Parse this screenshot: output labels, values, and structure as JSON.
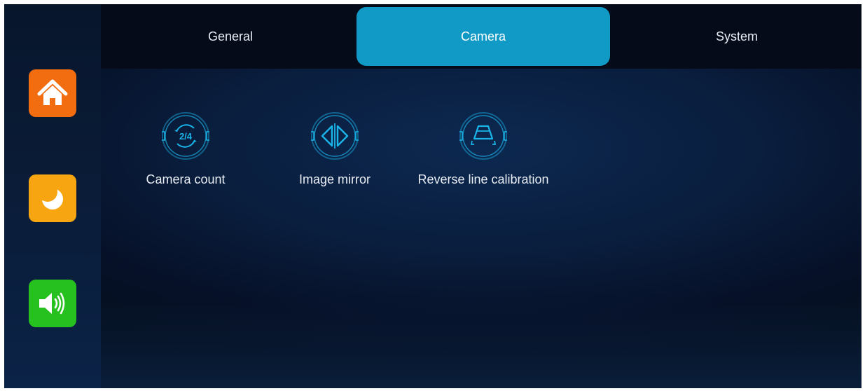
{
  "tabs": {
    "general": "General",
    "camera": "Camera",
    "system": "System",
    "active": "Camera"
  },
  "sidebar": {
    "home_icon": "home-icon",
    "night_icon": "moon-icon",
    "sound_icon": "speaker-icon"
  },
  "settings": {
    "camera_count": {
      "label": "Camera count",
      "icon_text": "2/4",
      "icon": "rotate-icon"
    },
    "image_mirror": {
      "label": "Image mirror",
      "icon": "mirror-icon"
    },
    "reverse_line": {
      "label": "Reverse line calibration",
      "icon": "reverse-lines-icon"
    }
  },
  "colors": {
    "active_tab": "#129ac6",
    "home": "#f26d0f",
    "night": "#f8a512",
    "sound": "#26c11f",
    "icon_accent": "#19b4e8"
  }
}
